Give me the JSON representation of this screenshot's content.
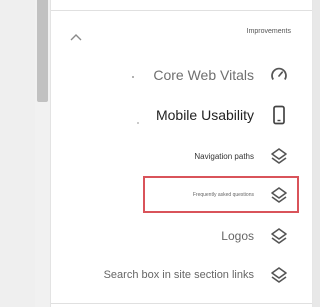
{
  "section": {
    "title": "Improvements"
  },
  "items": [
    {
      "label": "Core Web Vitals",
      "icon": "speedometer-icon"
    },
    {
      "label": "Mobile Usability",
      "icon": "smartphone-icon"
    },
    {
      "label": "Navigation paths",
      "icon": "layers-icon"
    },
    {
      "label": "Frequently asked questions",
      "icon": "layers-icon"
    },
    {
      "label": "Logos",
      "icon": "layers-icon"
    },
    {
      "label": "Search box in site section links",
      "icon": "layers-icon"
    }
  ],
  "highlight_color": "#d9535a"
}
